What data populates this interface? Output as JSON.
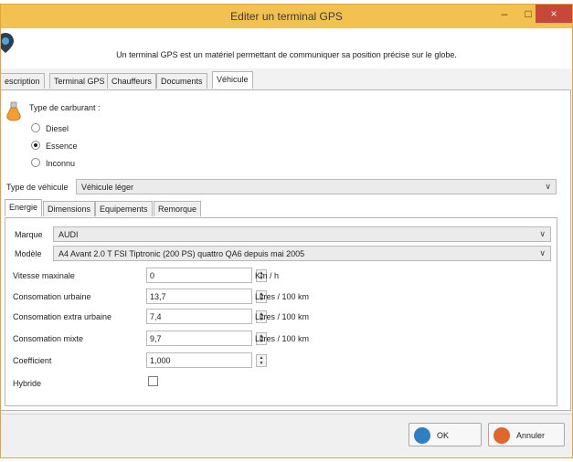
{
  "window": {
    "title": "Editer un terminal GPS",
    "minimize": "–",
    "maximize": "□",
    "close": "×"
  },
  "header": {
    "description": "Un terminal GPS est un matériel permettant de communiquer sa position précise sur le globe."
  },
  "tabs": [
    "escription",
    "Terminal GPS",
    "Chauffeurs",
    "Documents",
    "Véhicule"
  ],
  "fuel": {
    "label": "Type de carburant :",
    "options": [
      "Diesel",
      "Essence",
      "Inconnu"
    ],
    "selected": "Essence"
  },
  "vehicle_type": {
    "label": "Type de véhicule",
    "value": "Véhicule léger"
  },
  "subtabs": [
    "Energie",
    "Dimensions",
    "Equipements",
    "Remorque"
  ],
  "brand": {
    "label": "Marque",
    "value": "AUDI"
  },
  "model": {
    "label": "Modèle",
    "value": "A4 Avant 2.0 T FSI Tiptronic (200 PS) quattro QA6 depuis mai 2005"
  },
  "fields": [
    {
      "label": "Vitesse maxinale",
      "value": "0",
      "unit": "Km / h"
    },
    {
      "label": "Consomation urbaine",
      "value": "13,7",
      "unit": "Litres / 100 km"
    },
    {
      "label": "Consomation extra urbaine",
      "value": "7,4",
      "unit": "Litres / 100 km"
    },
    {
      "label": "Consomation mixte",
      "value": "9,7",
      "unit": "Litres / 100 km"
    },
    {
      "label": "Coefficient",
      "value": "1,000",
      "unit": ""
    }
  ],
  "hybrid": {
    "label": "Hybride",
    "checked": false
  },
  "buttons": {
    "ok": "OK",
    "cancel": "Annuler"
  },
  "colors": {
    "titlebar": "#f2c14f",
    "close": "#c7483a",
    "ok_icon": "#2f7fc4",
    "cancel_icon": "#e0672b"
  }
}
